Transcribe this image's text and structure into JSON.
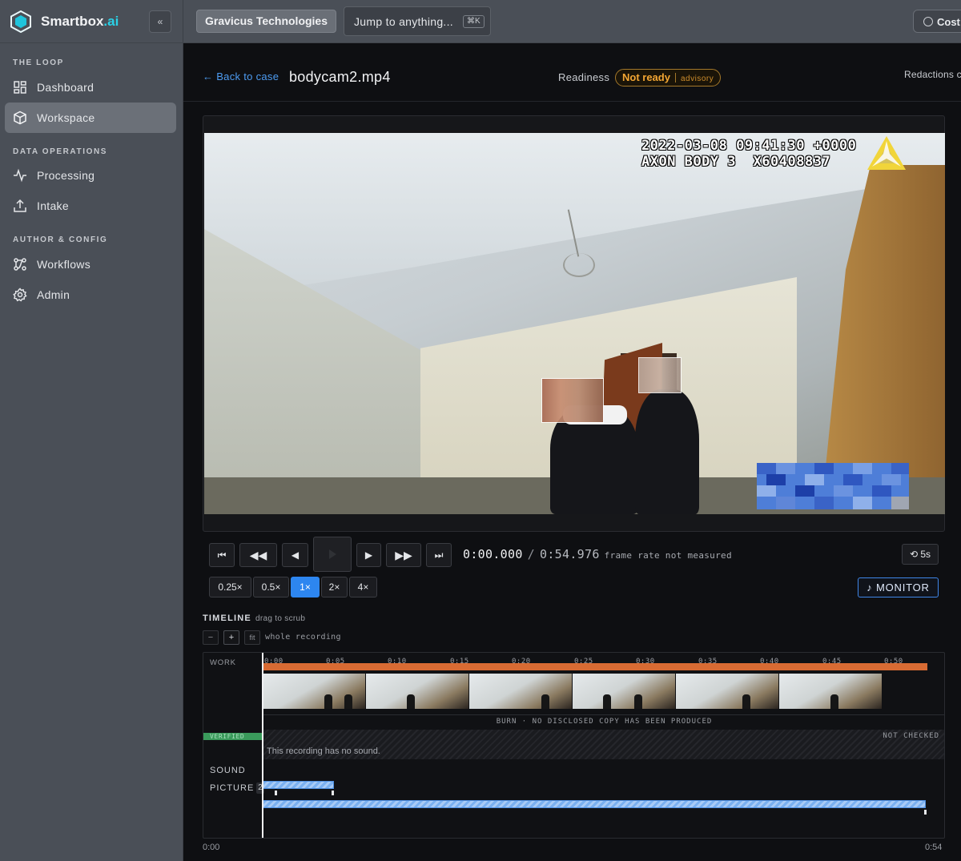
{
  "brand": {
    "name_main": "Smartbox",
    "name_suffix": ".ai",
    "collapse_label": "«"
  },
  "sidebar": {
    "sections": [
      {
        "label": "THE LOOP"
      },
      {
        "label": "DATA OPERATIONS"
      },
      {
        "label": "AUTHOR & CONFIG"
      }
    ],
    "items": [
      {
        "label": "Dashboard",
        "icon": "grid-icon",
        "active": false
      },
      {
        "label": "Workspace",
        "icon": "cube-icon",
        "active": true
      },
      {
        "label": "Processing",
        "icon": "pulse-icon",
        "active": false
      },
      {
        "label": "Intake",
        "icon": "upload-icon",
        "active": false
      },
      {
        "label": "Workflows",
        "icon": "flow-icon",
        "active": false
      },
      {
        "label": "Admin",
        "icon": "gear-icon",
        "active": false
      }
    ]
  },
  "topbar": {
    "org": "Gravicus Technologies",
    "jump_placeholder": "Jump to anything...",
    "jump_shortcut": "⌘K",
    "cost_label": "Cost"
  },
  "header": {
    "back_label": "← Back to case",
    "file_name": "bodycam2.mp4",
    "readiness_label": "Readiness",
    "readiness_status": "Not ready",
    "readiness_level": "advisory",
    "redactions_label": "Redactions c"
  },
  "video": {
    "hud_line1": "2022-03-08 09:41:30 +0000",
    "hud_line2": "AXON BODY 3  X60408837"
  },
  "controls": {
    "skip_start": "⏮",
    "rewind": "◀◀",
    "step_back": "◀",
    "play": "▶",
    "step_forward": "▶",
    "fast_forward": "▶▶",
    "skip_end": "⏭",
    "current_time": "0:00.000",
    "separator": "/",
    "total_time": "0:54.976",
    "frame_rate_note": "frame rate not measured",
    "back5_label": "⟲ 5s",
    "speeds": [
      "0.25×",
      "0.5×",
      "1×",
      "2×",
      "4×"
    ],
    "active_speed": "1×",
    "monitor_label": "♪ MONITOR"
  },
  "timeline": {
    "title": "TIMELINE",
    "hint": "drag to scrub",
    "zoom_out": "−",
    "zoom_in": "+",
    "fit": "fit",
    "range_label": "whole recording",
    "work_label": "WORK",
    "ticks": [
      "0:00",
      "0:05",
      "0:10",
      "0:15",
      "0:20",
      "0:25",
      "0:30",
      "0:35",
      "0:40",
      "0:45",
      "0:50"
    ],
    "burn_text": "BURN · NO DISCLOSED COPY HAS BEEN PRODUCED",
    "verified_label": "VERIFIED",
    "not_checked": "NOT CHECKED",
    "no_sound": "This recording has no sound.",
    "sound_label": "SOUND",
    "picture_label": "PICTURE",
    "picture_count": "2",
    "start_time": "0:00",
    "end_time": "0:54"
  },
  "colors": {
    "accent_blue": "#2d86f0",
    "work_orange": "#d86b33",
    "verified_green": "#3a9a5b",
    "warning_amber": "#f3a633",
    "brand_cyan": "#2ad1e6"
  }
}
